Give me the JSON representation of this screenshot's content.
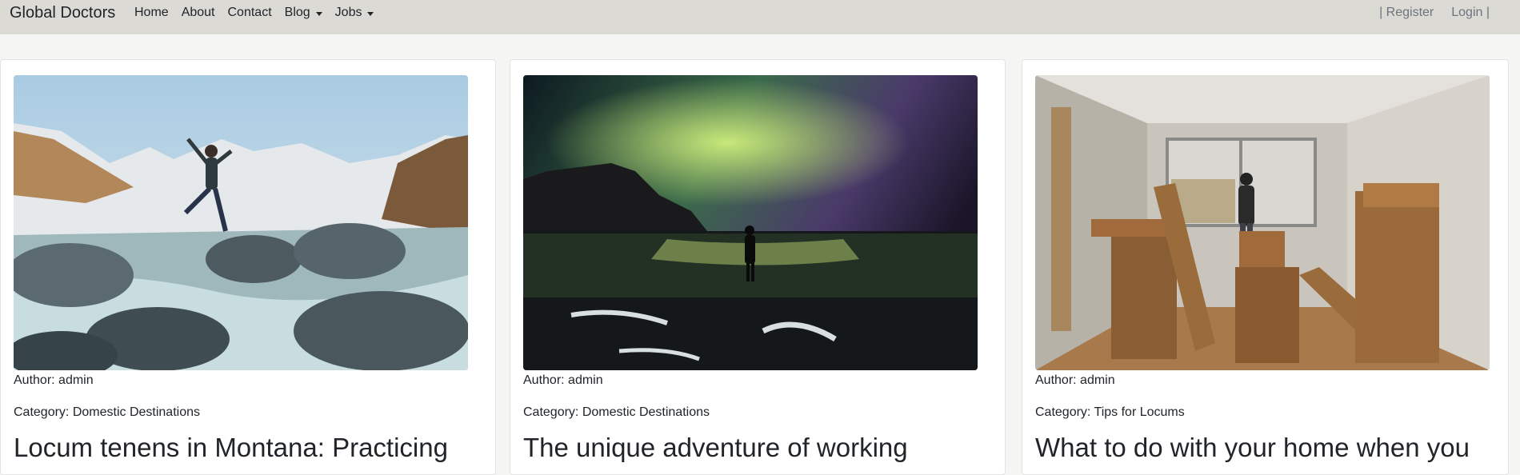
{
  "navbar": {
    "brand": "Global Doctors",
    "links": [
      "Home",
      "About",
      "Contact",
      "Blog",
      "Jobs"
    ],
    "register": "| Register",
    "login": "Login |"
  },
  "cards": [
    {
      "author_label": "Author:",
      "author": "admin",
      "category_label": "Category:",
      "category": "Domestic Destinations",
      "title": "Locum tenens in Montana: Practicing",
      "image": "mountain-river-jumper-photo"
    },
    {
      "author_label": "Author:",
      "author": "admin",
      "category_label": "Category:",
      "category": "Domestic Destinations",
      "title": "The unique adventure of working",
      "image": "aurora-beach-photo"
    },
    {
      "author_label": "Author:",
      "author": "admin",
      "category_label": "Category:",
      "category": "Tips for Locums",
      "title": "What to do with your home when you",
      "image": "moving-boxes-room-photo"
    }
  ]
}
